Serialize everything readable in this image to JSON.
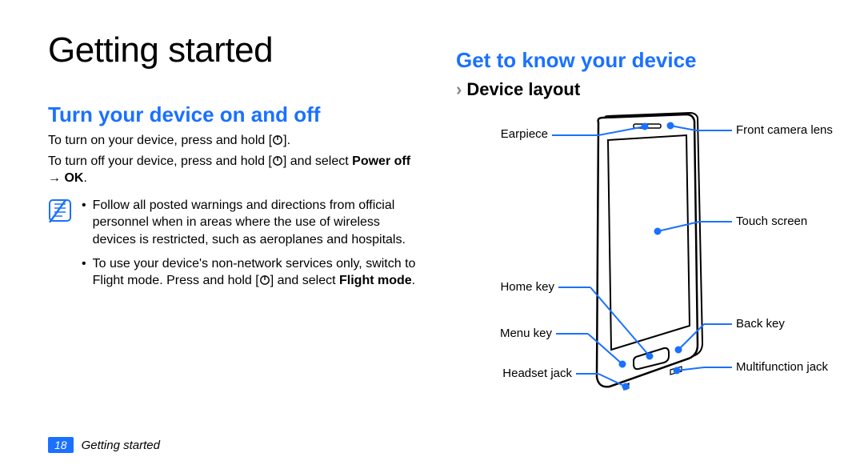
{
  "title": "Getting started",
  "left": {
    "heading": "Turn your device on and off",
    "turn_on_pre": "To turn on your device, press and hold [",
    "turn_on_post": "].",
    "turn_off_pre": "To turn off your device, press and hold [",
    "turn_off_post": "] and select ",
    "power_off_bold": "Power off → OK",
    "period": ".",
    "note_bullet1": "Follow all posted warnings and directions from official personnel when in areas where the use of wireless devices is restricted, such as aeroplanes and hospitals.",
    "note_bullet2_pre": "To use your device's non-network services only, switch to Flight mode. Press and hold [",
    "note_bullet2_post": "] and select ",
    "flight_mode_bold": "Flight mode",
    "period2": "."
  },
  "right": {
    "heading": "Get to know your device",
    "subheading": "Device layout",
    "labels": {
      "earpiece": "Earpiece",
      "home_key": "Home key",
      "menu_key": "Menu key",
      "headset_jack": "Headset jack",
      "front_camera_lens": "Front camera lens",
      "touch_screen": "Touch screen",
      "back_key": "Back key",
      "multifunction_jack": "Multifunction jack"
    }
  },
  "footer": {
    "page_number": "18",
    "section": "Getting started"
  },
  "colors": {
    "accent": "#1a71ff"
  }
}
